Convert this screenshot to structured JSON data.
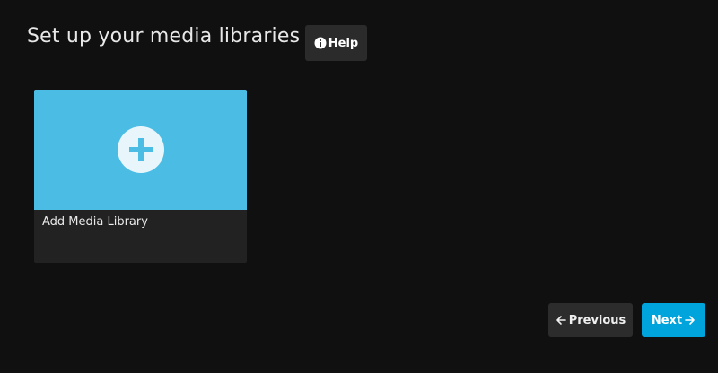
{
  "header": {
    "title": "Set up your media libraries",
    "help_label": "Help",
    "help_icon": "info-icon"
  },
  "libraries": {
    "add_card": {
      "label": "Add Media Library",
      "icon": "plus-circle-icon",
      "image_color": "#4bbde4"
    }
  },
  "footer": {
    "previous_label": "Previous",
    "previous_icon": "arrow-left-icon",
    "next_label": "Next",
    "next_icon": "arrow-right-icon"
  },
  "colors": {
    "background": "#101010",
    "accent": "#00a4dc",
    "card_background": "#222222"
  }
}
